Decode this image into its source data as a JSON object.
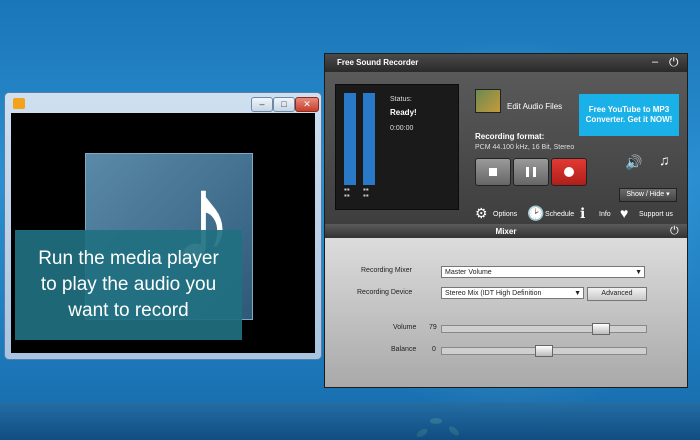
{
  "media_player": {
    "window_buttons": [
      "–",
      "□",
      "✕"
    ],
    "caption": [
      "Run the media player",
      "to play the audio you",
      "want to record"
    ]
  },
  "recorder": {
    "title": "Free Sound Recorder",
    "status_label": "Status:",
    "status_value": "Ready!",
    "time": "0:00:00",
    "edit_label": "Edit Audio Files",
    "promo": [
      "Free YouTube to MP3",
      "Converter. Get it NOW!"
    ],
    "format_label": "Recording format:",
    "format_value": "PCM 44.100 kHz, 16 Bit, Stereo",
    "show_hide": "Show / Hide",
    "options": [
      {
        "icon": "gear-icon",
        "label": "Options"
      },
      {
        "icon": "clock-icon",
        "label": "Schedule"
      },
      {
        "icon": "info-icon",
        "label": "Info"
      },
      {
        "icon": "heart-icon",
        "label": "Support us"
      }
    ]
  },
  "mixer": {
    "title": "Mixer",
    "recording_mixer_label": "Recording Mixer",
    "recording_mixer_value": "Master Volume",
    "recording_device_label": "Recording Device",
    "recording_device_value": "Stereo Mix (IDT High Definition",
    "advanced": "Advanced",
    "volume_label": "Volume",
    "volume_value": "79",
    "balance_label": "Balance",
    "balance_value": "0"
  }
}
